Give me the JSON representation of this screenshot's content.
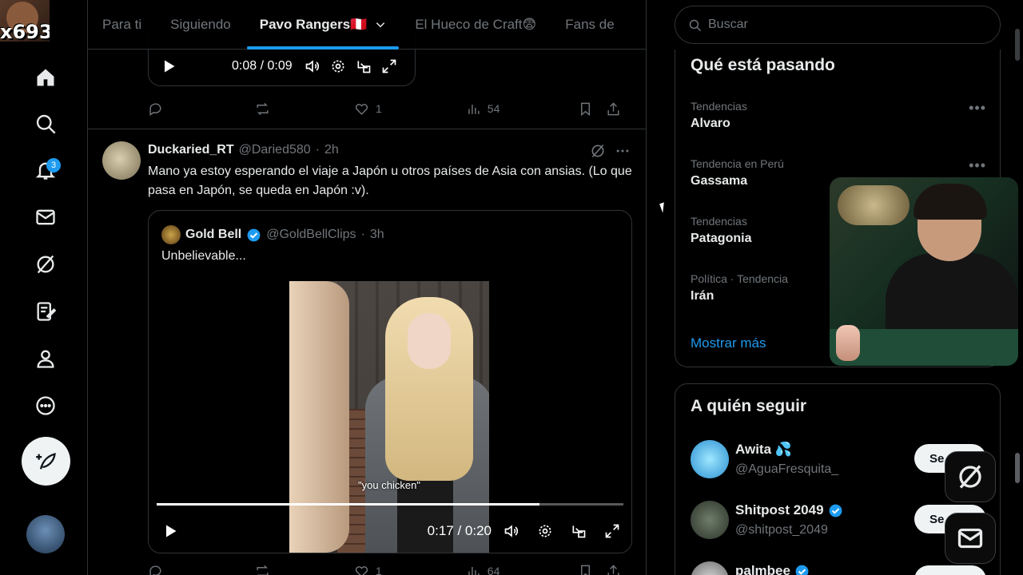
{
  "overlay": {
    "streamer_tag": "x693"
  },
  "nav": {
    "notification_count": "3"
  },
  "tabs": [
    {
      "label": "Para ti"
    },
    {
      "label": "Siguiendo"
    },
    {
      "label": "Pavo Rangers🇵🇪"
    },
    {
      "label": "El Hueco de Craft😨"
    },
    {
      "label": "Fans de"
    }
  ],
  "top_player": {
    "time": "0:08 / 0:09"
  },
  "top_actions": {
    "likes": "1",
    "views": "54"
  },
  "tweet": {
    "display_name": "Duckaried_RT",
    "handle": "@Daried580",
    "dot": "·",
    "time": "2h",
    "text": "Mano ya estoy esperando el viaje a Japón u otros países de Asia con ansias. (Lo que pasa en Japón, se queda en Japón :v)."
  },
  "quote": {
    "display_name": "Gold Bell",
    "handle": "@GoldBellClips",
    "dot": "·",
    "time": "3h",
    "text": "Unbelievable...",
    "subtitle": "\"you chicken\"",
    "video_time": "0:17 / 0:20",
    "progress": 0.82
  },
  "bottom_actions": {
    "likes": "1",
    "views": "64"
  },
  "search": {
    "placeholder": "Buscar"
  },
  "trends": {
    "title": "Qué está pasando",
    "items": [
      {
        "meta": "Tendencias",
        "topic": "Alvaro"
      },
      {
        "meta": "Tendencia en Perú",
        "topic": "Gassama"
      },
      {
        "meta": "Tendencias",
        "topic": "Patagonia"
      },
      {
        "meta": "Política · Tendencia",
        "topic": "Irán"
      }
    ],
    "show_more": "Mostrar más"
  },
  "who_to_follow": {
    "title": "A quién seguir",
    "items": [
      {
        "name": "Awita 💦",
        "handle": "@AguaFresquita_",
        "button": "Se"
      },
      {
        "name": "Shitpost 2049",
        "handle": "@shitpost_2049",
        "button": "Se"
      },
      {
        "name": "palmbee",
        "handle": "",
        "button": ""
      }
    ]
  },
  "colors": {
    "accent": "#1d9bf0",
    "background": "#000000",
    "border": "#2f3336",
    "muted": "#71767b"
  }
}
